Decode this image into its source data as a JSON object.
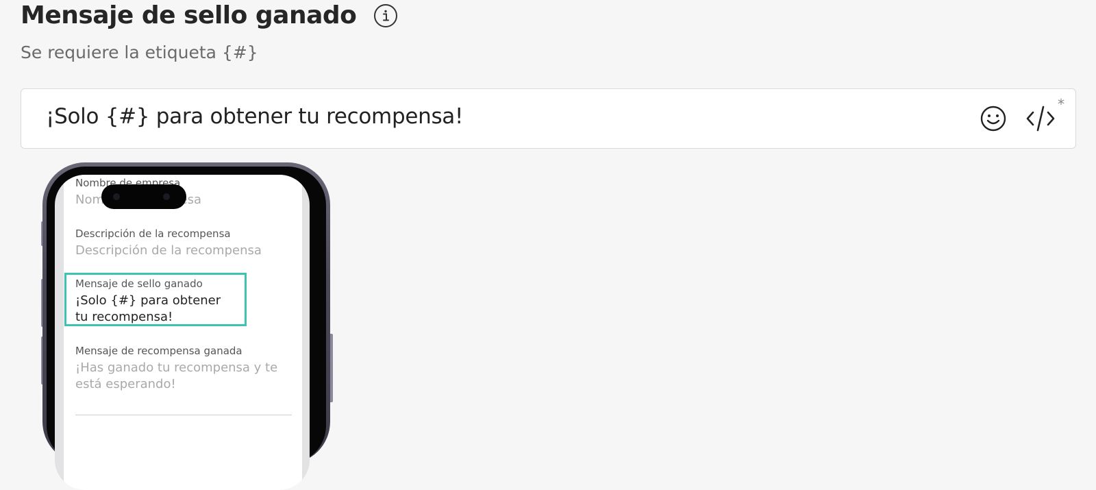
{
  "header": {
    "title": "Mensaje de sello ganado",
    "info_icon": "info-icon",
    "subtitle": "Se requiere la etiqueta {#}"
  },
  "message_input": {
    "value": "¡Solo {#} para obtener tu recompensa!",
    "emoji_icon": "smiley-icon",
    "code_icon": "code-tag-icon",
    "required_marker": "*"
  },
  "phone_preview": {
    "fields": [
      {
        "label": "Nombre de empresa",
        "value": "Nombre de empresa"
      },
      {
        "label": "Descripción de la recompensa",
        "value": "Descripción de la recompensa"
      },
      {
        "label": "Mensaje de sello ganado",
        "value": "¡Solo {#} para obtener tu recompensa!"
      },
      {
        "label": "Mensaje de recompensa ganada",
        "value": "¡Has ganado tu recompensa y te está esperando!"
      }
    ]
  },
  "colors": {
    "background": "#f6f6f6",
    "highlight": "#3fc1b3",
    "phone_frame": "#4a4756"
  }
}
